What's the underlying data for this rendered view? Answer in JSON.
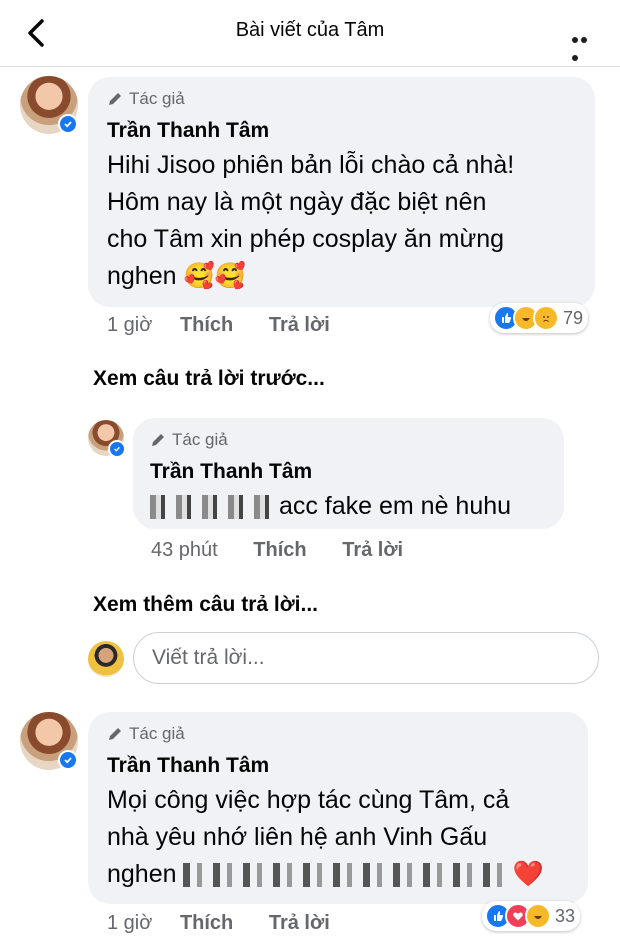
{
  "header": {
    "title": "Bài viết của Tâm"
  },
  "comments": [
    {
      "author_tag": "Tác giả",
      "name": "Trần Thanh Tâm",
      "text_lines": [
        "Hihi Jisoo phiên bản lỗi chào cả nhà!",
        "Hôm nay là một ngày đặc biệt nên",
        "cho Tâm xin phép cosplay ăn mừng",
        "nghen"
      ],
      "emoji": "🥰🥰",
      "time": "1 giờ",
      "like_label": "Thích",
      "reply_label": "Trả lời",
      "reaction_icons": [
        "like-reaction-icon",
        "haha-reaction-icon",
        "sad-reaction-icon"
      ],
      "reaction_count": "79"
    },
    {
      "author_tag": "Tác giả",
      "name": "Trần Thanh Tâm",
      "text_visible": "acc fake em nè huhu",
      "time": "43 phút",
      "like_label": "Thích",
      "reply_label": "Trả lời"
    },
    {
      "author_tag": "Tác giả",
      "name": "Trần Thanh Tâm",
      "text_lines": [
        "Mọi công việc hợp tác cùng Tâm, cả",
        "nhà yêu nhớ liên hệ anh Vinh Gấu"
      ],
      "text_last_prefix": "nghen",
      "emoji": "❤️",
      "time": "1 giờ",
      "like_label": "Thích",
      "reply_label": "Trả lời",
      "reaction_icons": [
        "like-reaction-icon",
        "love-reaction-icon",
        "haha-reaction-icon"
      ],
      "reaction_count": "33"
    }
  ],
  "see_previous": "Xem câu trả lời trước...",
  "see_more": "Xem thêm câu trả lời...",
  "reply_input": {
    "placeholder": "Viết trả lời..."
  },
  "colors": {
    "bubble": "#f0f2f5",
    "verified": "#1877f2",
    "meta": "#65676b"
  }
}
